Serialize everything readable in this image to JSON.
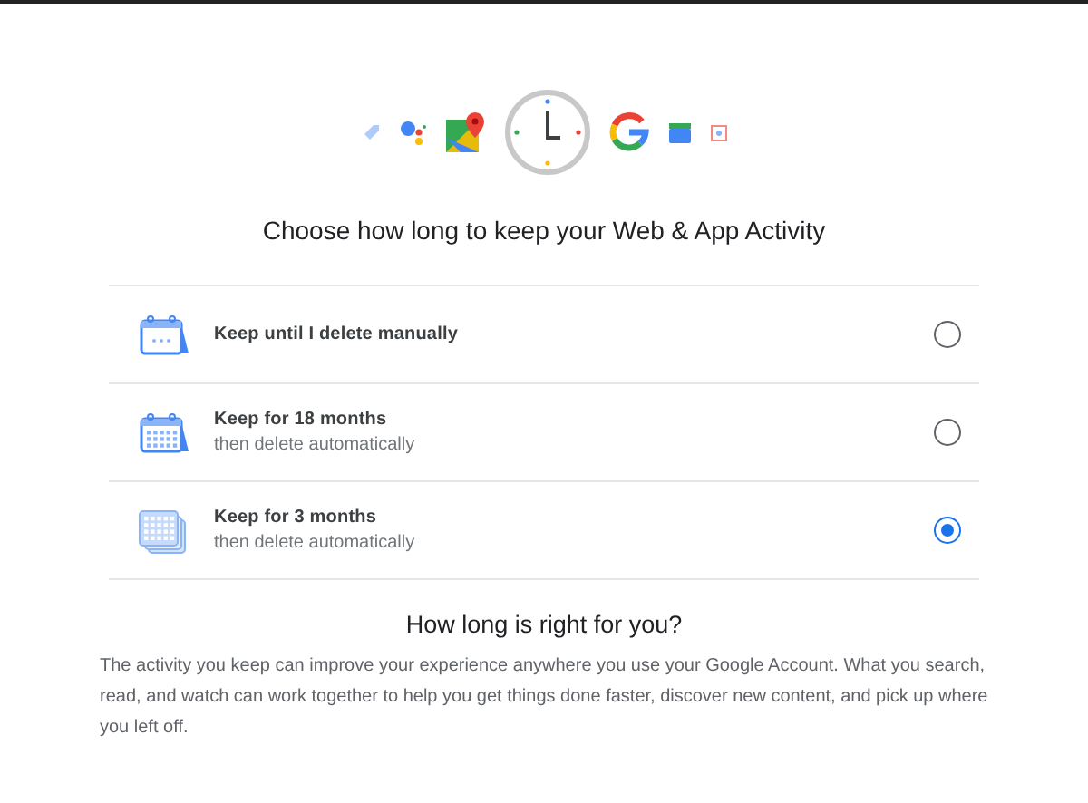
{
  "heading": "Choose how long to keep your Web & App Activity",
  "options": [
    {
      "kind": "calendar",
      "title": "Keep until I delete manually",
      "selected": false
    },
    {
      "kind": "calendar-grid",
      "title": "Keep for 18 months",
      "subtitle": "then delete automatically",
      "selected": false
    },
    {
      "kind": "calendar-stack",
      "title": "Keep for 3 months",
      "subtitle": "then delete automatically",
      "selected": true
    }
  ],
  "info": {
    "title": "How long is right for you?",
    "body": "The activity you keep can improve your experience anywhere you use your Google Account. What you search, read, and watch can work together to help you get things done faster, discover new content, and pick up where you left off."
  }
}
